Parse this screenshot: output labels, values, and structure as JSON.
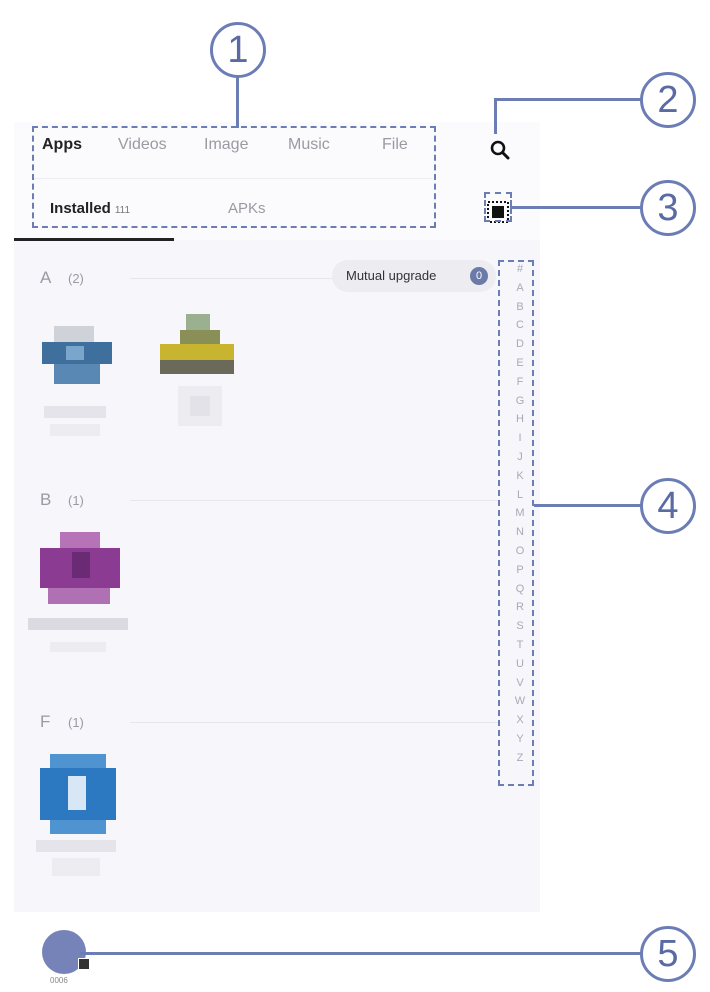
{
  "tabs": {
    "main": [
      {
        "label": "Apps",
        "active": true
      },
      {
        "label": "Videos",
        "active": false
      },
      {
        "label": "Image",
        "active": false
      },
      {
        "label": "Music",
        "active": false
      },
      {
        "label": "File",
        "active": false
      }
    ],
    "sub": [
      {
        "label": "Installed",
        "count": "111",
        "active": true
      },
      {
        "label": "APKs",
        "active": false
      }
    ]
  },
  "toolbar": {
    "search_icon": "search-icon",
    "select_icon": "select-all-icon"
  },
  "mutual_upgrade": {
    "label": "Mutual upgrade",
    "badge": "0"
  },
  "sections": [
    {
      "letter": "A",
      "count": "(2)"
    },
    {
      "letter": "B",
      "count": "(1)"
    },
    {
      "letter": "F",
      "count": "(1)"
    }
  ],
  "az_index": [
    "#",
    "A",
    "B",
    "C",
    "D",
    "E",
    "F",
    "G",
    "H",
    "I",
    "J",
    "K",
    "L",
    "M",
    "N",
    "O",
    "P",
    "Q",
    "R",
    "S",
    "T",
    "U",
    "V",
    "W",
    "X",
    "Y",
    "Z"
  ],
  "bottom": {
    "avatar_label": "0006"
  },
  "callouts": [
    "1",
    "2",
    "3",
    "4",
    "5"
  ],
  "colors": {
    "accent": "#6c7db5",
    "badge": "#6b7aa8",
    "avatar": "#7583b9"
  }
}
